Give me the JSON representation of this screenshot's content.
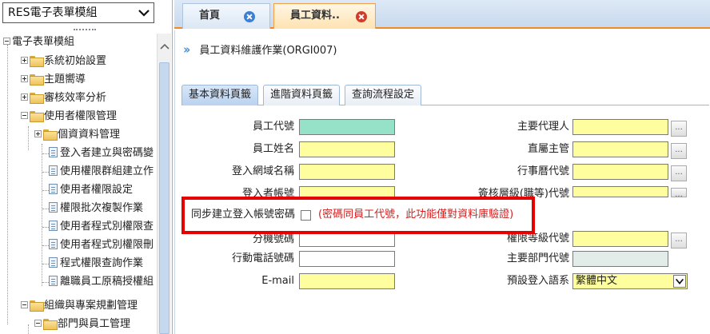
{
  "module_select": {
    "value": "RES電子表單模組"
  },
  "tree": {
    "root": "電子表單模組",
    "items": [
      {
        "label": "系統初始設置",
        "type": "folder"
      },
      {
        "label": "主題嚮導",
        "type": "folder"
      },
      {
        "label": "審核效率分析",
        "type": "folder"
      },
      {
        "label": "使用者權限管理",
        "type": "folder"
      },
      {
        "label": "個資資料管理",
        "type": "folder"
      },
      {
        "label": "登入者建立與密碼變",
        "type": "page"
      },
      {
        "label": "使用權限群組建立作",
        "type": "page"
      },
      {
        "label": "使用者權限設定",
        "type": "page"
      },
      {
        "label": "權限批次複製作業",
        "type": "page"
      },
      {
        "label": "使用者程式別權限查",
        "type": "page"
      },
      {
        "label": "使用者程式別權限刪",
        "type": "page"
      },
      {
        "label": "程式權限查詢作業",
        "type": "page"
      },
      {
        "label": "離職員工原稿授權組",
        "type": "page"
      },
      {
        "label": "組織與專案規劃管理",
        "type": "folder"
      },
      {
        "label": "部門與員工管理",
        "type": "folder"
      }
    ]
  },
  "doc_tabs": [
    {
      "label": "首頁"
    },
    {
      "label": "員工資料.."
    }
  ],
  "form": {
    "title": "員工資料維護作業(ORGI007)",
    "sub_tabs": [
      "基本資料頁籤",
      "進階資料頁籤",
      "查詢流程設定"
    ],
    "left_fields": [
      {
        "label": "員工代號"
      },
      {
        "label": "員工姓名"
      },
      {
        "label": "登入網域名稱"
      },
      {
        "label": "登入者帳號"
      }
    ],
    "sync": {
      "label": "同步建立登入帳號密碼",
      "note": "(密碼同員工代號，此功能僅對資料庫驗證)"
    },
    "left_fields_2": [
      {
        "label": "分機號碼"
      },
      {
        "label": "行動電話號碼"
      },
      {
        "label": "E-mail"
      }
    ],
    "right_fields": [
      {
        "label": "主要代理人"
      },
      {
        "label": "直屬主管"
      },
      {
        "label": "行事曆代號"
      },
      {
        "label": "簽核層級(職等)代號"
      },
      {
        "label": "權限等級代號"
      },
      {
        "label": "主要部門代號"
      },
      {
        "label": "預設登入語系",
        "value": "繁體中文"
      }
    ],
    "pick_button_label": "..."
  },
  "colors": {
    "required": "#fffe9e",
    "key_field": "#95e2c8",
    "highlight": "#e60000",
    "note_text": "#d42020",
    "active_tab_accent": "#f08a24"
  }
}
